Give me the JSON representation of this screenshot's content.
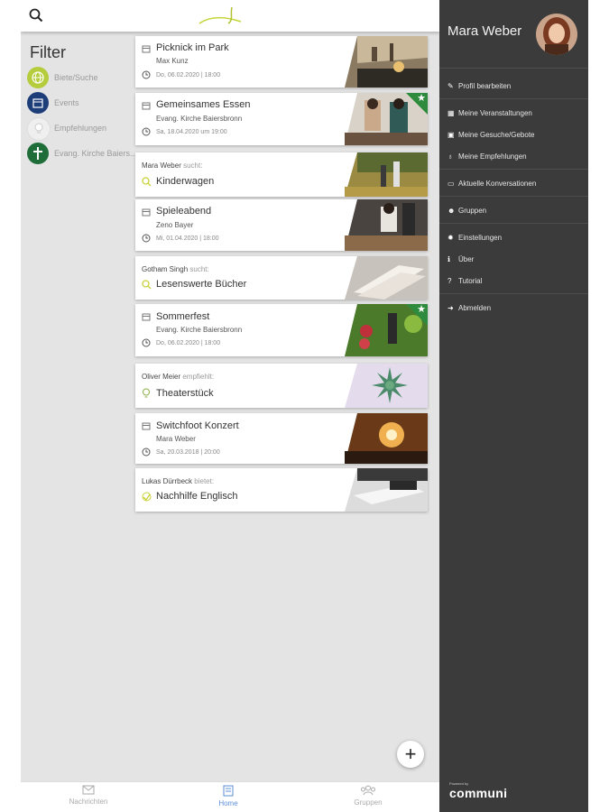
{
  "search": {
    "icon": "search-icon"
  },
  "filter": {
    "title": "Filter",
    "items": [
      {
        "label": "Biete/Suche",
        "icon": "globe-icon",
        "color": "#b5cc3c"
      },
      {
        "label": "Events",
        "icon": "calendar-icon",
        "color": "#1d3e78"
      },
      {
        "label": "Empfehlungen",
        "icon": "lightbulb-icon",
        "color": "#efefef"
      },
      {
        "label": "Evang. Kirche Baiers...",
        "icon": "church-icon",
        "color": "#1f6e3a"
      }
    ]
  },
  "feed": [
    {
      "type": "event",
      "title": "Picknick im Park",
      "organizer": "Max Kunz",
      "date": "Do, 06.02.2020 | 18:00",
      "image": "park-photo",
      "featured": false
    },
    {
      "type": "event",
      "title": "Gemeinsames Essen",
      "organizer": "Evang. Kirche Baiersbronn",
      "date": "Sa, 18.04.2020 um 19:00",
      "image": "dinner-photo",
      "featured": true
    },
    {
      "type": "request",
      "user": "Mara Weber",
      "verb": "sucht:",
      "title": "Kinderwagen",
      "image": "family-photo"
    },
    {
      "type": "event",
      "title": "Spieleabend",
      "organizer": "Zeno Bayer",
      "date": "Mi, 01.04.2020 | 18:00",
      "image": "games-photo",
      "featured": false
    },
    {
      "type": "request",
      "user": "Gotham Singh",
      "verb": "sucht:",
      "title": "Lesenswerte Bücher",
      "image": "books-photo"
    },
    {
      "type": "event",
      "title": "Sommerfest",
      "organizer": "Evang. Kirche Baiersbronn",
      "date": "Do, 06.02.2020 | 18:00",
      "image": "flowers-photo",
      "featured": true
    },
    {
      "type": "recommendation",
      "user": "Oliver Meier",
      "verb": "empfiehlt:",
      "title": "Theaterstück",
      "image": "succulent-photo"
    },
    {
      "type": "event",
      "title": "Switchfoot Konzert",
      "organizer": "Mara Weber",
      "date": "Sa, 20.03.2018 | 20:00",
      "image": "concert-photo",
      "featured": false
    },
    {
      "type": "offer",
      "user": "Lukas Dürrbeck",
      "verb": "bietet:",
      "title": "Nachhilfe Englisch",
      "image": "study-photo"
    }
  ],
  "fab": {
    "label": "+"
  },
  "bottom_nav": [
    {
      "label": "Nachrichten",
      "icon": "mail-icon",
      "active": false
    },
    {
      "label": "Home",
      "icon": "book-icon",
      "active": true
    },
    {
      "label": "Gruppen",
      "icon": "group-icon",
      "active": false
    }
  ],
  "drawer": {
    "user_name": "Mara Weber",
    "avatar": "user-avatar",
    "menu": [
      {
        "label": "Profil bearbeiten",
        "icon": "edit-icon"
      },
      {
        "label": "Meine Veranstaltungen",
        "icon": "calendar-icon"
      },
      {
        "label": "Meine Gesuche/Gebote",
        "icon": "gift-icon"
      },
      {
        "label": "Meine Empfehlungen",
        "icon": "lightbulb-icon"
      },
      {
        "label": "Aktuelle Konversationen",
        "icon": "chat-icon"
      },
      {
        "label": "Gruppen",
        "icon": "group-icon"
      },
      {
        "label": "Einstellungen",
        "icon": "gear-icon"
      },
      {
        "label": "Über",
        "icon": "info-icon"
      },
      {
        "label": "Tutorial",
        "icon": "question-icon"
      },
      {
        "label": "Abmelden",
        "icon": "logout-icon"
      }
    ],
    "powered_by": "Powered by",
    "brand": "communi"
  },
  "colors": {
    "drawer_bg": "#3b3b3b",
    "featured_badge": "#2e8b3d",
    "active_nav": "#5b8ed6",
    "app_bg": "#e4e4e4"
  }
}
